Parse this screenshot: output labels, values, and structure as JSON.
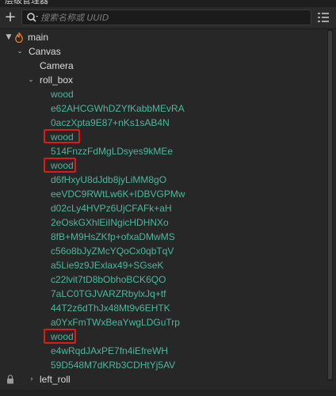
{
  "panel": {
    "title": "层级管理器"
  },
  "toolbar": {
    "add_icon": "plus-icon",
    "search": {
      "placeholder": "搜索名称或 UUID",
      "value": ""
    },
    "menu_icon": "sort-menu-icon"
  },
  "tree": {
    "main": "main",
    "canvas": "Canvas",
    "camera": "Camera",
    "roll_box": "roll_box",
    "children": [
      "wood",
      "e62AHCGWhDZYfKabbMEvRA",
      "0aczXpta9E87+nKs1sAB4N",
      "wood",
      "514FnzzFdMgLDsyes9kMEe",
      "wood",
      "d6fHxyU8dJdb8jyLiMM8gO",
      "eeVDC9RWtLw6K+IDBVGPMw",
      "d02cLy4HVPz6UjCFAFk+aH",
      "2eOskGXhlEiINgicHDHNXo",
      "8fB+M9HsZKfp+ofxaDMwMS",
      "c56o8bJyZMcYQoCx0qbTqV",
      "a5Lie9z9JExlax49+SGseK",
      "c22lvit7tD8bObhoBCK6QO",
      "7aLC0TGJVARZRbylxJq+tf",
      "44T2z6dThJx48Mt9v6EHTK",
      "a0YxFmTWxBeaYwgLDGuTrp",
      "wood",
      "e4wRqdJAxPE7fn4iEfreWH",
      "59D548M7dKRb3CDHtYj5AV"
    ],
    "left_roll": "left_roll"
  },
  "colors": {
    "background": "#272727",
    "prefab_text": "#4cb89a",
    "node_text": "#dcdcdc",
    "highlight_box": "#e01818",
    "root_icon": "#e6842a"
  }
}
